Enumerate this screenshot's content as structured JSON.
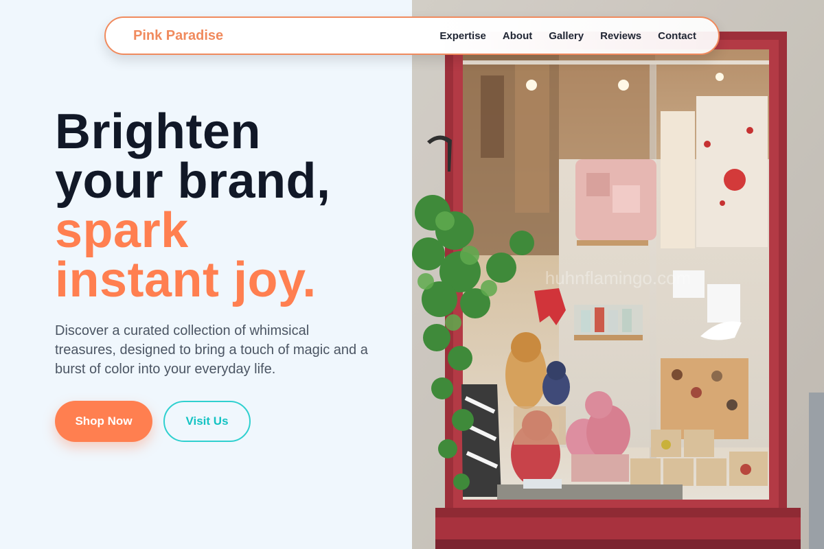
{
  "brand": {
    "name": "Pink Paradise",
    "color": "#f08a5d"
  },
  "nav": {
    "items": [
      {
        "label": "Expertise"
      },
      {
        "label": "About"
      },
      {
        "label": "Gallery"
      },
      {
        "label": "Reviews"
      },
      {
        "label": "Contact"
      }
    ]
  },
  "hero": {
    "title_line1": "Brighten",
    "title_line2": "your brand,",
    "title_line3": "spark",
    "title_line4": "instant joy.",
    "description": "Discover a curated collection of whimsical treasures, designed to bring a touch of magic and a burst of color into your everyday life.",
    "primary_cta": "Shop Now",
    "secondary_cta": "Visit Us"
  },
  "photo": {
    "watermark": "huhnflamingo.com",
    "alt": "Shop window display of a boutique with stuffed animals, bird prints and plants"
  },
  "colors": {
    "accent": "#ff7f50",
    "teal": "#2fd0cf",
    "dark": "#111827",
    "bg": "#f0f7fd",
    "frame": "#a8323e"
  }
}
